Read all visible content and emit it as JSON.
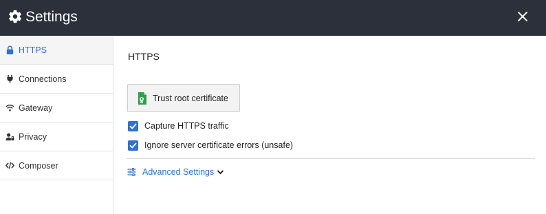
{
  "window": {
    "title": "Settings",
    "icon": "gear-icon",
    "close_icon": "close-icon"
  },
  "sidebar": {
    "items": [
      {
        "label": "HTTPS",
        "icon": "lock-icon",
        "active": true
      },
      {
        "label": "Connections",
        "icon": "plug-icon",
        "active": false
      },
      {
        "label": "Gateway",
        "icon": "wifi-icon",
        "active": false
      },
      {
        "label": "Privacy",
        "icon": "user-lock-icon",
        "active": false
      },
      {
        "label": "Composer",
        "icon": "code-icon",
        "active": false
      }
    ]
  },
  "main": {
    "section_title": "HTTPS",
    "trust_button": {
      "label": "Trust root certificate",
      "icon": "certificate-icon"
    },
    "checkboxes": [
      {
        "label": "Capture HTTPS traffic",
        "checked": true
      },
      {
        "label": "Ignore server certificate errors (unsafe)",
        "checked": true
      }
    ],
    "advanced": {
      "label": "Advanced Settings",
      "icon": "sliders-icon",
      "expanded": false
    }
  },
  "colors": {
    "titlebar_bg": "#2b303b",
    "accent": "#2f6fd6",
    "certificate_green": "#2e9e4f"
  }
}
